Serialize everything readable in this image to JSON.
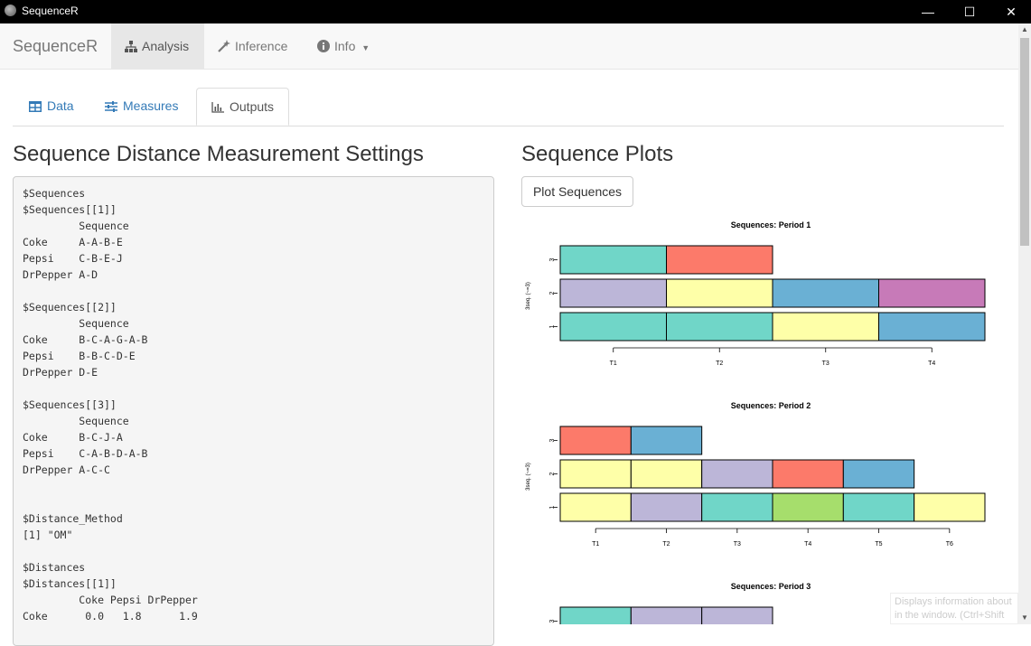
{
  "window": {
    "title": "SequenceR",
    "minimize": "—",
    "maximize": "☐",
    "close": "✕"
  },
  "navbar": {
    "brand": "SequenceR",
    "items": [
      {
        "label": "Analysis",
        "icon": "sitemap-icon",
        "active": true
      },
      {
        "label": "Inference",
        "icon": "magic-wand-icon",
        "active": false
      },
      {
        "label": "Info",
        "icon": "info-circle-icon",
        "active": false,
        "dropdown": true
      }
    ]
  },
  "tabs": [
    {
      "label": "Data",
      "icon": "table-icon",
      "active": false
    },
    {
      "label": "Measures",
      "icon": "sliders-icon",
      "active": false
    },
    {
      "label": "Outputs",
      "icon": "bar-chart-icon",
      "active": true
    }
  ],
  "left": {
    "heading": "Sequence Distance Measurement Settings",
    "output": "$Sequences\n$Sequences[[1]]\n         Sequence\nCoke     A-A-B-E\nPepsi    C-B-E-J\nDrPepper A-D\n\n$Sequences[[2]]\n         Sequence\nCoke     B-C-A-G-A-B\nPepsi    B-B-C-D-E\nDrPepper D-E\n\n$Sequences[[3]]\n         Sequence\nCoke     B-C-J-A\nPepsi    C-A-B-D-A-B\nDrPepper A-C-C\n\n\n$Distance_Method\n[1] \"OM\"\n\n$Distances\n$Distances[[1]]\n         Coke Pepsi DrPepper\nCoke      0.0   1.8      1.9"
  },
  "right": {
    "heading": "Sequence Plots",
    "button": "Plot Sequences"
  },
  "palette": {
    "A": "#70d6c8",
    "B": "#bcb6d8",
    "C": "#feffa8",
    "D": "#fc7a6a",
    "E": "#6ab0d4",
    "G": "#a6de6c",
    "J": "#c77ab8"
  },
  "chart_data": [
    {
      "type": "bar",
      "title": "Sequences: Period 1",
      "ylabel": "3seq. (~=3)",
      "x": [
        "T1",
        "T2",
        "T3",
        "T4"
      ],
      "rows": [
        {
          "label": "3",
          "states": [
            "A",
            "D"
          ]
        },
        {
          "label": "2",
          "states": [
            "B",
            "C",
            "E",
            "J"
          ]
        },
        {
          "label": "1",
          "states": [
            "A",
            "A",
            "C",
            "E"
          ]
        }
      ]
    },
    {
      "type": "bar",
      "title": "Sequences: Period 2",
      "ylabel": "3seq. (~=3)",
      "x": [
        "T1",
        "T2",
        "T3",
        "T4",
        "T5",
        "T6"
      ],
      "rows": [
        {
          "label": "3",
          "states": [
            "D",
            "E"
          ]
        },
        {
          "label": "2",
          "states": [
            "C",
            "C",
            "B",
            "D",
            "E"
          ]
        },
        {
          "label": "1",
          "states": [
            "C",
            "B",
            "A",
            "G",
            "A",
            "C"
          ]
        }
      ]
    },
    {
      "type": "bar",
      "title": "Sequences: Period 3",
      "ylabel": "",
      "x": [],
      "rows": [
        {
          "label": "3",
          "states": [
            "A",
            "B",
            "B"
          ]
        }
      ]
    }
  ],
  "tooltip": {
    "line1": "Displays information about",
    "line2": "in the window. (Ctrl+Shift"
  }
}
